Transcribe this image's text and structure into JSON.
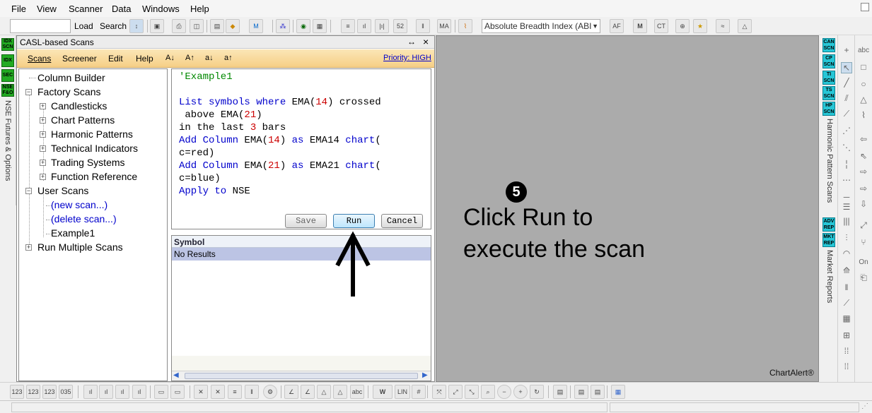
{
  "menu": [
    "File",
    "View",
    "Scanner",
    "Data",
    "Windows",
    "Help"
  ],
  "toolbar": {
    "load_label": "Load",
    "search_label": "Search",
    "indicator_select": "Absolute Breadth Index (ABI"
  },
  "left_tabs": [
    "IDX SCN",
    "IDX",
    "SEC",
    "NSE F&O"
  ],
  "left_vertical_label": "NSE Futures & Options",
  "panel": {
    "title": "CASL-based Scans",
    "pin": "↔",
    "close": "×",
    "menu": [
      "Scans",
      "Screener",
      "Edit",
      "Help"
    ],
    "font_buttons": [
      "A↓",
      "A↑",
      "a↓",
      "a↑"
    ],
    "priority": "Priority: HIGH"
  },
  "tree": [
    {
      "label": "Column Builder",
      "level": 0,
      "expander": "",
      "link": false
    },
    {
      "label": "Factory Scans",
      "level": 0,
      "expander": "−",
      "link": false
    },
    {
      "label": "Candlesticks",
      "level": 1,
      "expander": "+",
      "link": false
    },
    {
      "label": "Chart Patterns",
      "level": 1,
      "expander": "+",
      "link": false
    },
    {
      "label": "Harmonic Patterns",
      "level": 1,
      "expander": "+",
      "link": false
    },
    {
      "label": "Technical Indicators",
      "level": 1,
      "expander": "+",
      "link": false
    },
    {
      "label": "Trading Systems",
      "level": 1,
      "expander": "+",
      "link": false
    },
    {
      "label": "Function Reference",
      "level": 1,
      "expander": "+",
      "link": false
    },
    {
      "label": "User Scans",
      "level": 0,
      "expander": "−",
      "link": false
    },
    {
      "label": "(new scan...)",
      "level": 1,
      "expander": "",
      "link": true
    },
    {
      "label": "(delete scan...)",
      "level": 1,
      "expander": "",
      "link": true
    },
    {
      "label": "Example1",
      "level": 1,
      "expander": "",
      "link": false
    },
    {
      "label": "Run Multiple Scans",
      "level": 0,
      "expander": "+",
      "link": false
    }
  ],
  "editor": {
    "lines": [
      [
        {
          "t": "'Example1",
          "c": "cm"
        }
      ],
      [],
      [
        {
          "t": "List symbols where ",
          "c": "kw"
        },
        {
          "t": "EMA(",
          "c": ""
        },
        {
          "t": "14",
          "c": "num"
        },
        {
          "t": ") ",
          "c": ""
        },
        {
          "t": "crossed",
          "c": ""
        }
      ],
      [
        {
          "t": " above ",
          "c": ""
        },
        {
          "t": "EMA(",
          "c": ""
        },
        {
          "t": "21",
          "c": "num"
        },
        {
          "t": ")",
          "c": ""
        }
      ],
      [
        {
          "t": "in the last ",
          "c": ""
        },
        {
          "t": "3",
          "c": "num"
        },
        {
          "t": " bars",
          "c": ""
        }
      ],
      [
        {
          "t": "Add Column ",
          "c": "kw"
        },
        {
          "t": "EMA(",
          "c": ""
        },
        {
          "t": "14",
          "c": "num"
        },
        {
          "t": ") ",
          "c": ""
        },
        {
          "t": "as ",
          "c": "kw"
        },
        {
          "t": "EMA14 ",
          "c": ""
        },
        {
          "t": "chart",
          "c": "kw"
        },
        {
          "t": "(",
          "c": ""
        }
      ],
      [
        {
          "t": "c=red)",
          "c": ""
        }
      ],
      [
        {
          "t": "Add Column ",
          "c": "kw"
        },
        {
          "t": "EMA(",
          "c": ""
        },
        {
          "t": "21",
          "c": "num"
        },
        {
          "t": ") ",
          "c": ""
        },
        {
          "t": "as ",
          "c": "kw"
        },
        {
          "t": "EMA21 ",
          "c": ""
        },
        {
          "t": "chart",
          "c": "kw"
        },
        {
          "t": "(",
          "c": ""
        }
      ],
      [
        {
          "t": "c=blue)",
          "c": ""
        }
      ],
      [
        {
          "t": "Apply to ",
          "c": "kw"
        },
        {
          "t": "NSE",
          "c": ""
        }
      ]
    ],
    "save_label": "Save",
    "run_label": "Run",
    "cancel_label": "Cancel"
  },
  "results": {
    "header": "Symbol",
    "empty_text": "No Results"
  },
  "annotation": {
    "step_number": "5",
    "line1": "Click Run to",
    "line2": "execute the scan",
    "brand": "ChartAlert®"
  },
  "right_tabs": [
    "CAN SCN",
    "CP SCN",
    "TI SCN",
    "TS SCN",
    "HP SCN",
    "ADV REP",
    "MKT REP"
  ],
  "right_vertical_labels": [
    "Harmonic Pattern Scans",
    "Market Reports"
  ],
  "colors": {
    "accent_orange": "#f6cf86",
    "tab_green": "#22aa22",
    "tab_cyan": "#26c6d6",
    "keyword_blue": "#0000cc",
    "number_red": "#cc0000",
    "comment_green": "#008800",
    "canvas_gray": "#ababab"
  }
}
